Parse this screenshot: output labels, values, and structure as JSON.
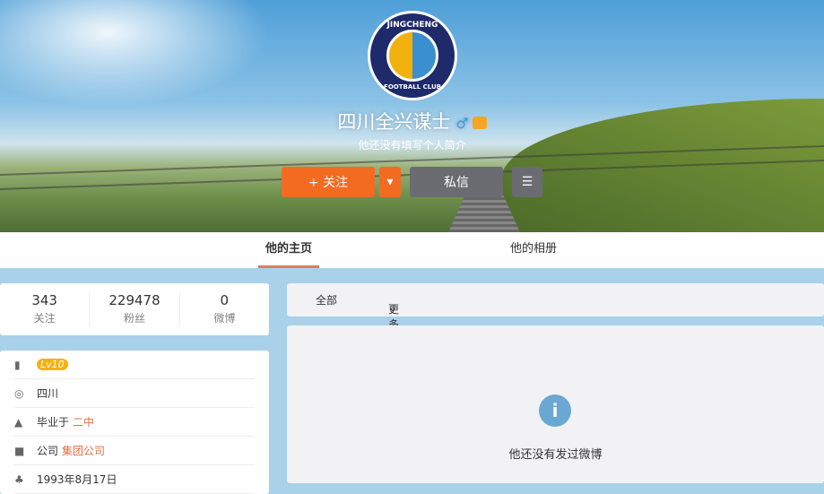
{
  "profile": {
    "name": "四川全兴谋士",
    "gender_icon": "♂",
    "bio": "他还没有填写个人简介",
    "logo_text_top": "JINGCHENG",
    "logo_text_bottom": "FOOTBALL CLUB"
  },
  "actions": {
    "follow": "+ 关注",
    "message": "私信"
  },
  "tabs": [
    {
      "label": "他的主页"
    },
    {
      "label": "他的相册"
    }
  ],
  "stats": [
    {
      "value": "343",
      "label": "关注"
    },
    {
      "value": "229478",
      "label": "粉丝"
    },
    {
      "value": "0",
      "label": "微博"
    }
  ],
  "info": {
    "level": "Lv10",
    "location": "四川",
    "school_prefix": "毕业于",
    "school": "二中",
    "company_prefix": "公司",
    "company": "集团公司",
    "birthday": "1993年8月17日"
  },
  "filter": {
    "all": "全部",
    "more": "更多"
  },
  "feed": {
    "empty": "他还没有发过微博"
  },
  "colors": {
    "accent": "#f36b21",
    "link": "#e0703f",
    "background": "#a9d1ea"
  }
}
